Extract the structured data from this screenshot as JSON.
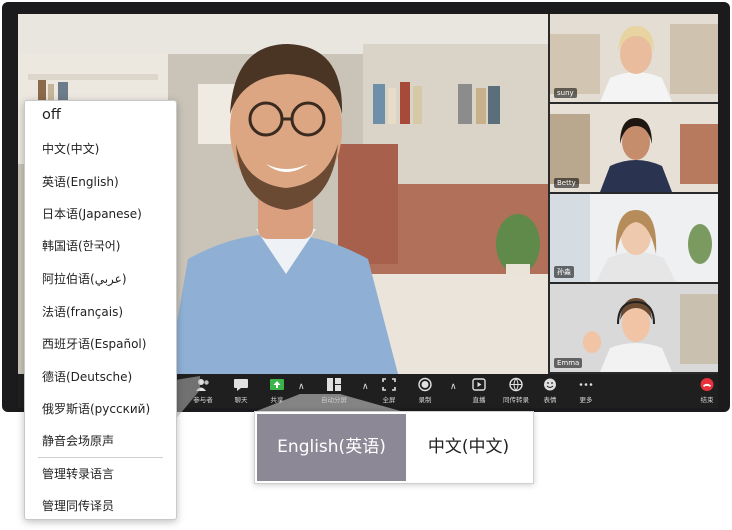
{
  "thumbnails": [
    {
      "name": "suny"
    },
    {
      "name": "Betty"
    },
    {
      "name": "孙淼"
    },
    {
      "name": "Emma"
    }
  ],
  "toolbar": {
    "items": [
      {
        "id": "participants",
        "label": "参与者",
        "icon": "participants-icon"
      },
      {
        "id": "chat",
        "label": "聊天",
        "icon": "chat-icon"
      },
      {
        "id": "share",
        "label": "共享",
        "icon": "share-icon",
        "color": "#3bb54a"
      },
      {
        "id": "auto-split",
        "label": "自动分屏",
        "icon": "split-screen-icon"
      },
      {
        "id": "fullscreen",
        "label": "全屏",
        "icon": "fullscreen-icon"
      },
      {
        "id": "record",
        "label": "录制",
        "icon": "record-icon"
      },
      {
        "id": "live",
        "label": "直播",
        "icon": "live-icon"
      },
      {
        "id": "interpret",
        "label": "同传转录",
        "icon": "interpretation-icon"
      },
      {
        "id": "reaction",
        "label": "表情",
        "icon": "emoji-icon"
      },
      {
        "id": "more",
        "label": "更多",
        "icon": "more-icon"
      },
      {
        "id": "end",
        "label": "结束",
        "icon": "end-call-icon",
        "color": "#e8323c"
      }
    ]
  },
  "language_menu": {
    "items": [
      "off",
      "中文(中文)",
      "英语(English)",
      "日本语(Japanese)",
      "韩国语(한국어)",
      "阿拉伯语(عربي)",
      "法语(français)",
      "西班牙语(Español)",
      "德语(Deutsche)",
      "俄罗斯语(русский)",
      "静音会场原声"
    ],
    "manage_items": [
      "管理转录语言",
      "管理同传译员"
    ]
  },
  "language_toggle": {
    "active": "English(英语)",
    "inactive": "中文(中文)",
    "active_color": "#8c8896"
  }
}
